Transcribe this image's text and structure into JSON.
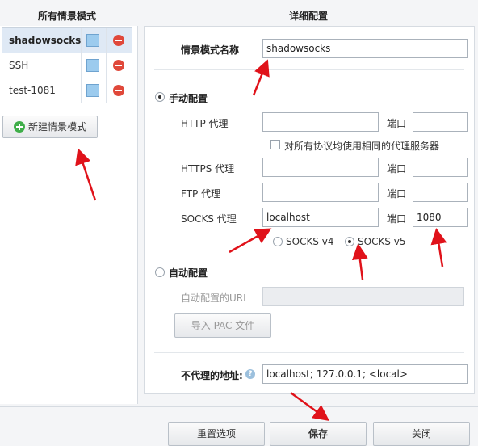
{
  "left_panel": {
    "header": "所有情景模式",
    "profiles": [
      {
        "name": "shadowsocks",
        "selected": true,
        "color": "#9ccbee"
      },
      {
        "name": "SSH",
        "selected": false,
        "color": "#9ccbee"
      },
      {
        "name": "test-1081",
        "selected": false,
        "color": "#9ccbee"
      }
    ],
    "new_profile_label": "新建情景模式"
  },
  "right_panel": {
    "header": "详细配置",
    "profile_name_label": "情景模式名称",
    "profile_name_value": "shadowsocks",
    "manual": {
      "label": "手动配置",
      "selected": true,
      "port_label": "端口",
      "http": {
        "label": "HTTP 代理",
        "host": "",
        "port": ""
      },
      "same_proxy_label": "对所有协议均使用相同的代理服务器",
      "same_proxy_checked": false,
      "https": {
        "label": "HTTPS 代理",
        "host": "",
        "port": ""
      },
      "ftp": {
        "label": "FTP 代理",
        "host": "",
        "port": ""
      },
      "socks": {
        "label": "SOCKS 代理",
        "host": "localhost",
        "port": "1080"
      },
      "socks_v4_label": "SOCKS v4",
      "socks_v5_label": "SOCKS v5",
      "socks_version": "v5"
    },
    "auto": {
      "label": "自动配置",
      "selected": false,
      "url_label": "自动配置的URL",
      "url_value": "",
      "import_pac_label": "导入 PAC 文件"
    },
    "bypass_label": "不代理的地址:",
    "bypass_value": "localhost; 127.0.0.1; <local>"
  },
  "footer": {
    "reset_label": "重置选项",
    "save_label": "保存",
    "close_label": "关闭"
  },
  "colors": {
    "annotation_arrow": "#e0121a",
    "selected_row": "#dfe9f5",
    "delete_icon": "#e0483a",
    "add_icon": "#3fae49"
  }
}
